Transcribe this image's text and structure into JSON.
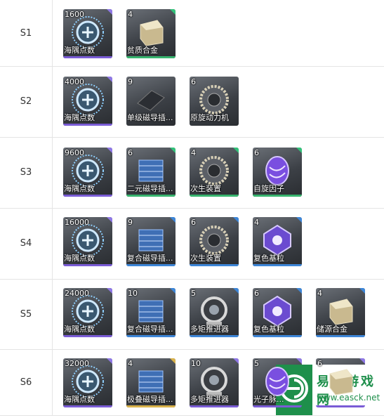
{
  "colors": {
    "bar_purple": "#7a5cd6",
    "bar_blue": "#3d86d8",
    "bar_green": "#37b46e",
    "corner_purple": "#8f78e6",
    "corner_green": "#32c27a",
    "corner_gold": "#d9b24a"
  },
  "rows": [
    {
      "stage": "S1",
      "items": [
        {
          "count": "1600",
          "name": "海隅点数",
          "icon": "sea-corner-points-icon",
          "rarity": "purple"
        },
        {
          "count": "4",
          "name": "贫质合金",
          "icon": "poor-alloy-icon",
          "rarity": "green"
        }
      ]
    },
    {
      "stage": "S2",
      "items": [
        {
          "count": "4000",
          "name": "海隅点数",
          "icon": "sea-corner-points-icon",
          "rarity": "purple"
        },
        {
          "count": "9",
          "name": "单级磁导插...",
          "icon": "single-magnetic-plug-icon",
          "rarity": "none"
        },
        {
          "count": "6",
          "name": "原旋动力机",
          "icon": "spin-engine-icon",
          "rarity": "none"
        }
      ]
    },
    {
      "stage": "S3",
      "items": [
        {
          "count": "9600",
          "name": "海隅点数",
          "icon": "sea-corner-points-icon",
          "rarity": "purple"
        },
        {
          "count": "6",
          "name": "二元磁导插...",
          "icon": "binary-magnetic-plug-icon",
          "rarity": "green"
        },
        {
          "count": "4",
          "name": "次生装置",
          "icon": "secondary-device-icon",
          "rarity": "green"
        },
        {
          "count": "6",
          "name": "自旋因子",
          "icon": "spin-factor-icon",
          "rarity": "green"
        }
      ]
    },
    {
      "stage": "S4",
      "items": [
        {
          "count": "16000",
          "name": "海隅点数",
          "icon": "sea-corner-points-icon",
          "rarity": "purple"
        },
        {
          "count": "9",
          "name": "复合磁导插...",
          "icon": "composite-magnetic-plug-icon",
          "rarity": "blue"
        },
        {
          "count": "6",
          "name": "次生装置",
          "icon": "secondary-device-icon",
          "rarity": "blue"
        },
        {
          "count": "4",
          "name": "复色基粒",
          "icon": "multicolor-grain-icon",
          "rarity": "blue"
        }
      ]
    },
    {
      "stage": "S5",
      "items": [
        {
          "count": "24000",
          "name": "海隅点数",
          "icon": "sea-corner-points-icon",
          "rarity": "purple"
        },
        {
          "count": "10",
          "name": "复合磁导插...",
          "icon": "composite-magnetic-plug-icon",
          "rarity": "blue"
        },
        {
          "count": "5",
          "name": "多矩推进器",
          "icon": "multi-moment-thruster-icon",
          "rarity": "blue"
        },
        {
          "count": "6",
          "name": "复色基粒",
          "icon": "multicolor-grain-icon",
          "rarity": "blue"
        },
        {
          "count": "4",
          "name": "储源合金",
          "icon": "storage-alloy-icon",
          "rarity": "blue"
        }
      ]
    },
    {
      "stage": "S6",
      "items": [
        {
          "count": "32000",
          "name": "海隅点数",
          "icon": "sea-corner-points-icon",
          "rarity": "purple"
        },
        {
          "count": "4",
          "name": "极叠磁导插...",
          "icon": "stacked-magnetic-plug-icon",
          "rarity": "gold"
        },
        {
          "count": "10",
          "name": "多矩推进器",
          "icon": "multi-moment-thruster-icon",
          "rarity": "purple"
        },
        {
          "count": "5",
          "name": "光子脉...",
          "icon": "photon-pulse-icon",
          "rarity": "purple"
        },
        {
          "count": "6",
          "name": "",
          "icon": "metal-block-icon",
          "rarity": "purple"
        }
      ]
    }
  ],
  "watermark": {
    "name": "易采游戏网",
    "url": "www.easck.net"
  }
}
